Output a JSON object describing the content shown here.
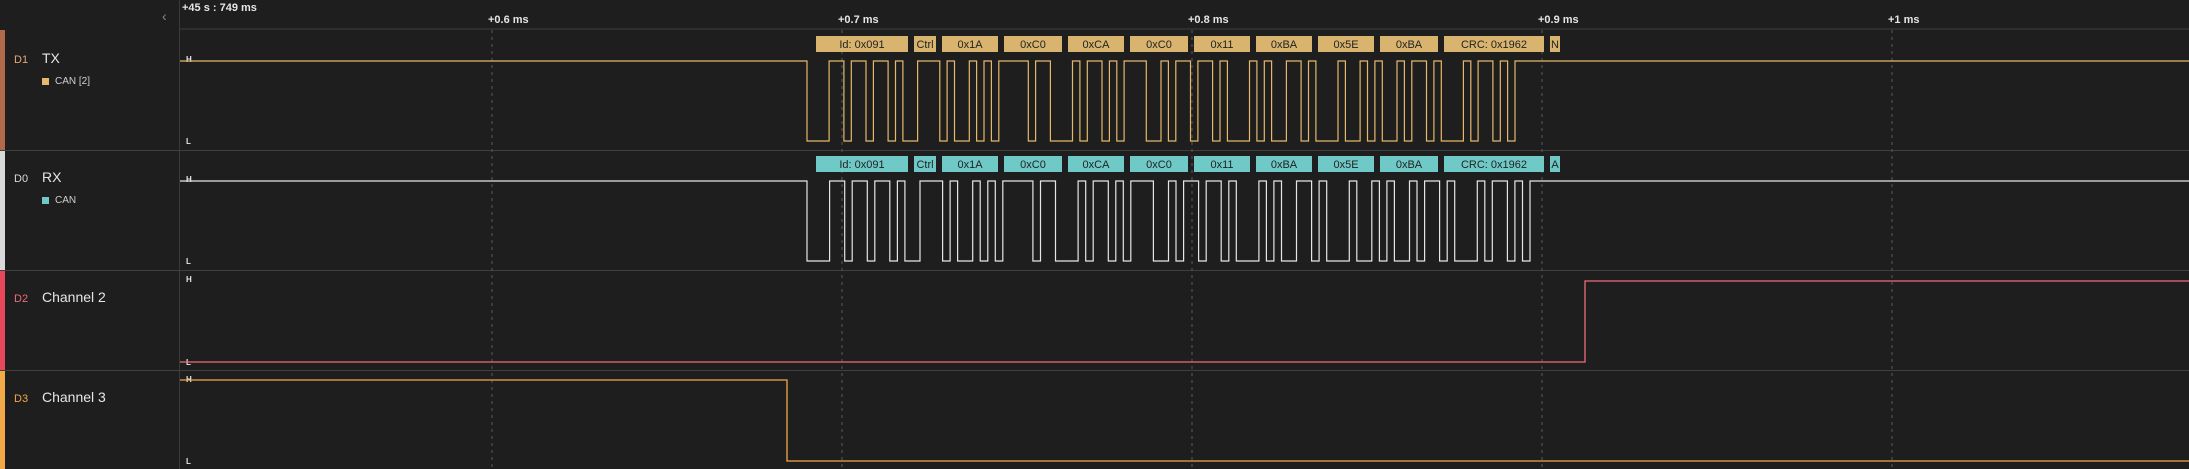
{
  "ruler": {
    "start_label": "+45 s : 749 ms",
    "ticks": [
      "+0.6 ms",
      "+0.7 ms",
      "+0.8 ms",
      "+0.9 ms",
      "+1 ms"
    ]
  },
  "channels": [
    {
      "id": "D1",
      "name": "TX",
      "analyzer": "CAN [2]",
      "color": "#e7b86a",
      "accent": "#b06a4a"
    },
    {
      "id": "D0",
      "name": "RX",
      "analyzer": "CAN",
      "color": "#e6e6e6",
      "accent": "#d9d9d9",
      "analyzer_color": "#6fcac7"
    },
    {
      "id": "D2",
      "name": "Channel 2",
      "analyzer": "",
      "color": "#ef6b7b",
      "accent": "#e8465a"
    },
    {
      "id": "D3",
      "name": "Channel 3",
      "analyzer": "",
      "color": "#f2a948",
      "accent": "#f2a948"
    }
  ],
  "level_labels": {
    "high": "H",
    "low": "L"
  },
  "tx_frames": [
    "Id: 0x091",
    "Ctrl",
    "0x1A",
    "0xC0",
    "0xCA",
    "0xC0",
    "0x11",
    "0xBA",
    "0x5E",
    "0xBA",
    "CRC: 0x1962",
    "N"
  ],
  "rx_frames": [
    "Id: 0x091",
    "Ctrl",
    "0x1A",
    "0xC0",
    "0xCA",
    "0xC0",
    "0x11",
    "0xBA",
    "0x5E",
    "0xBA",
    "CRC: 0x1962",
    "A"
  ],
  "colors": {
    "tx_frame": "#d9b46e",
    "rx_frame": "#6fcac7",
    "grid": "#5a5a5a"
  }
}
